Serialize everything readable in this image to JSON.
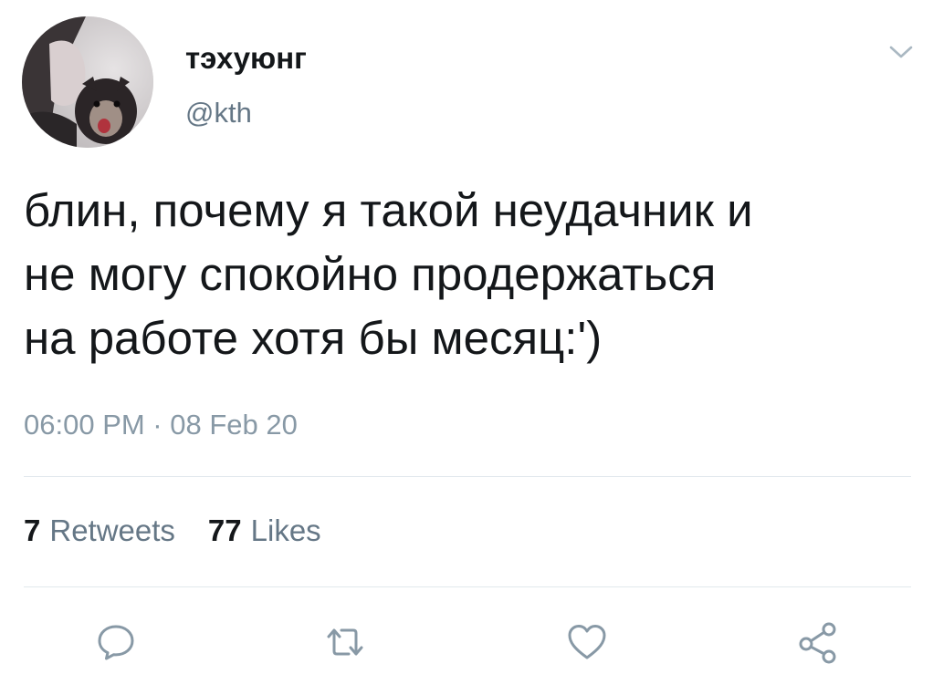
{
  "tweet": {
    "author": {
      "display_name": "тэхуюнг",
      "handle": "@kth",
      "avatar_icon": "profile-photo"
    },
    "text_lines": [
      "блин, почему я такой неудачник и",
      "не могу спокойно продержаться",
      "на работе хотя бы месяц:')"
    ],
    "timestamp": "06:00 PM · 08 Feb 20",
    "stats": {
      "retweets_count": "7",
      "retweets_label": "Retweets",
      "likes_count": "77",
      "likes_label": "Likes"
    },
    "actions": {
      "reply_icon": "reply-icon",
      "retweet_icon": "retweet-icon",
      "like_icon": "heart-icon",
      "share_icon": "share-icon",
      "menu_icon": "chevron-down-icon"
    },
    "colors": {
      "text_primary": "#14171a",
      "text_secondary": "#657786",
      "icon_gray": "#8899a6",
      "divider": "#e1e8ed"
    }
  }
}
